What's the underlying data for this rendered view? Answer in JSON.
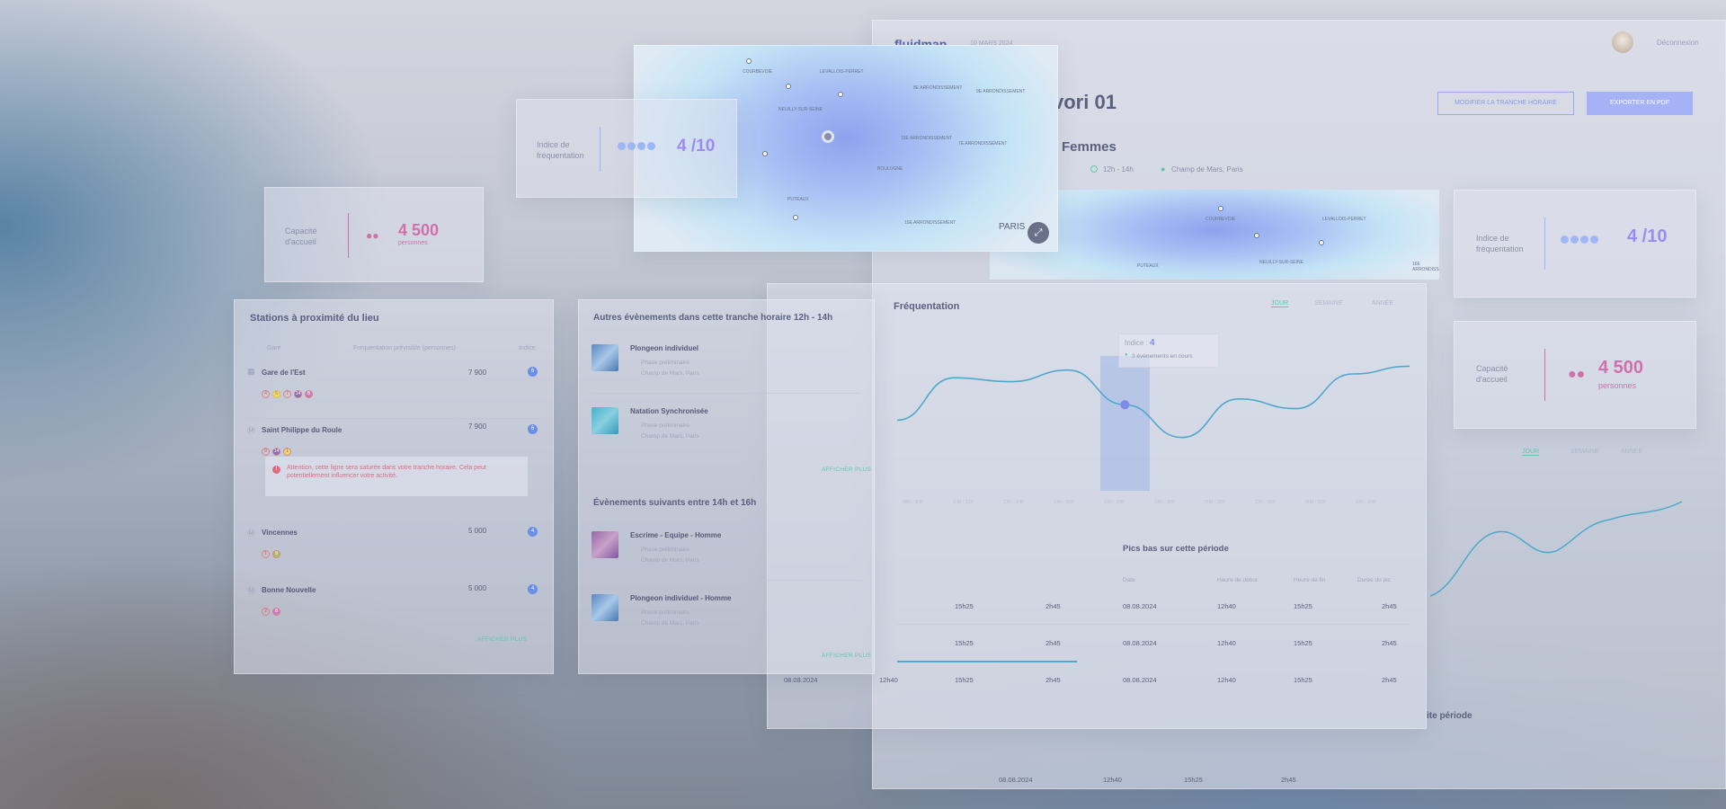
{
  "header": {
    "logo": "fluidmap",
    "date": "10 MARS 2024",
    "logout": "Déconnexion",
    "title": "vori 01",
    "subtitle": "Femmes",
    "time": "12h - 14h",
    "place": "Champ de Mars, Paris",
    "btn_modify": "MODIFIER LA TRANCHE HORAIRE",
    "btn_export": "EXPORTER EN PDF"
  },
  "freq_card": {
    "label": "Indice de fréquentation",
    "value": "4 /10",
    "level": 4,
    "max": 5
  },
  "capacity_card": {
    "label": "Capacité d'accueil",
    "value": "4 500",
    "unit": "personnes"
  },
  "map": {
    "labels": [
      "Courbevoie",
      "Levallois-Perret",
      "8E ARRONDISSEMENT",
      "Neuilly-sur-Seine",
      "9E ARRONDISSEMENT",
      "16E ARRONDISSEMENT",
      "7E ARRONDISSEMENT",
      "PARIS",
      "15E ARRONDISSEMENT",
      "Puteaux",
      "Boulogne"
    ],
    "paris": "PARIS"
  },
  "stations": {
    "title": "Stations à proximité du lieu",
    "cols": [
      "Gare",
      "Fréquentation prévisible (personnes)",
      "Indice"
    ],
    "items": [
      {
        "name": "Gare de l'Est",
        "value": "7 900",
        "index": "6",
        "lines": [
          "4",
          "5",
          "7",
          "14",
          "B"
        ]
      },
      {
        "name": "Saint Philippe du Roule",
        "value": "7 900",
        "index": "6",
        "lines": [
          "9",
          "14",
          "1"
        ]
      },
      {
        "name": "Vincennes",
        "value": "5 000",
        "index": "4",
        "lines": [
          "1",
          "9"
        ]
      },
      {
        "name": "Bonne Nouvelle",
        "value": "5 000",
        "index": "4",
        "lines": [
          "2",
          "8"
        ]
      }
    ],
    "warning": "Attention, cette ligne sera saturée dans votre tranche horaire. Cela peut potentiellement influencer votre activité.",
    "more": "AFFICHER PLUS"
  },
  "events": {
    "title": "Autres évènements dans cette tranche horaire 12h - 14h",
    "items": [
      {
        "name": "Plongeon individuel",
        "phase": "Phase préliminaire",
        "place": "Champ de Mars, Paris"
      },
      {
        "name": "Natation Synchronisée",
        "phase": "Phase préliminaire",
        "place": "Champ de Mars, Paris"
      }
    ],
    "more": "AFFICHER PLUS",
    "next_title": "Évènements suivants entre 14h et 16h",
    "next_items": [
      {
        "name": "Escrime - Equipe - Homme",
        "phase": "Phase préliminaire",
        "place": "Champ de Mars, Paris"
      },
      {
        "name": "Plongeon individuel - Homme",
        "phase": "Phase préliminaire",
        "place": "Champ de Mars, Paris"
      }
    ],
    "next_more": "AFFICHER PLUS"
  },
  "chart": {
    "title": "Fréquentation",
    "tabs": [
      "JOUR",
      "SEMAINE",
      "ANNÉE"
    ],
    "tooltip_label": "Indice :",
    "tooltip_value": "4",
    "tooltip_events": "3 évènements en cours",
    "ticks": [
      "08h - 10h",
      "10h - 12h",
      "12h - 14h",
      "14h - 16h",
      "16h - 18h",
      "18h - 20h",
      "20h - 22h",
      "22h - 00h",
      "00h - 02h",
      "02h - 04h"
    ]
  },
  "chart_data": {
    "type": "line",
    "y": [
      3.2,
      5.4,
      5.2,
      5.8,
      4.0,
      2.3,
      4.3,
      3.8,
      5.6,
      6.0
    ],
    "highlight_index": 4
  },
  "lows": {
    "title": "Pics bas sur cette période",
    "cols": [
      "Date",
      "Heure de début",
      "Heure de fin",
      "Durée du pic"
    ],
    "rows": [
      [
        "08.08.2024",
        "12h40",
        "15h25",
        "2h45"
      ],
      [
        "08.08.2024",
        "12h40",
        "15h25",
        "2h45"
      ],
      [
        "08.08.2024",
        "12h40",
        "15h25",
        "2h45"
      ]
    ]
  },
  "bottom": {
    "title": "ite période",
    "row": [
      "08.08.2024",
      "12h40",
      "15h25",
      "2h45"
    ]
  }
}
